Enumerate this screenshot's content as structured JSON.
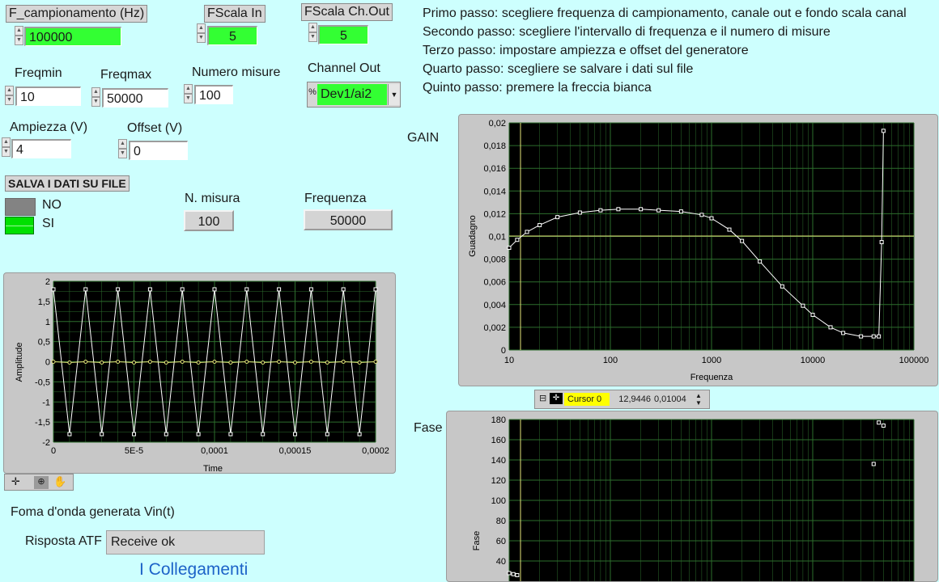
{
  "controls": {
    "f_camp": {
      "label": "F_campionamento (Hz)",
      "value": "100000"
    },
    "fscala_in": {
      "label": "FScala In",
      "value": "5"
    },
    "fscala_out": {
      "label": "FScala Ch.Out",
      "value": "5"
    },
    "freqmin": {
      "label": "Freqmin",
      "value": "10"
    },
    "freqmax": {
      "label": "Freqmax",
      "value": "50000"
    },
    "num_misure": {
      "label": "Numero misure",
      "value": "100"
    },
    "channel_out": {
      "label": "Channel Out",
      "value": "Dev1/ai2",
      "prefix": "%"
    },
    "ampiezza": {
      "label": "Ampiezza (V)",
      "value": "4"
    },
    "offset": {
      "label": "Offset (V)",
      "value": "0"
    }
  },
  "salva": {
    "title": "SALVA I DATI SU FILE",
    "options": [
      "NO",
      "SI"
    ],
    "selected": "SI"
  },
  "indicators": {
    "n_misura": {
      "label": "N. misura",
      "value": "100"
    },
    "frequenza": {
      "label": "Frequenza",
      "value": "50000"
    }
  },
  "instructions": [
    "Primo passo: scegliere frequenza di campionamento, canale out e fondo scala canal",
    "Secondo passo: scegliere l'intervallo di frequenza e il numero di misure",
    "Terzo passo: impostare ampiezza e offset del generatore",
    "Quarto passo: scegliere se salvare i dati sul file",
    "Quinto passo: premere la freccia bianca"
  ],
  "waveform": {
    "caption": "Foma d'onda generata Vin(t)",
    "xlabel": "Time",
    "ylabel": "Amplitude"
  },
  "risposta": {
    "label": "Risposta ATF",
    "value": "Receive ok"
  },
  "collegamenti": "I Collegamenti",
  "gain": {
    "title": "GAIN",
    "xlabel": "Frequenza",
    "ylabel": "Guadagno"
  },
  "cursor": {
    "name": "Cursor 0",
    "x": "12,9446",
    "y": "0,01004"
  },
  "fase": {
    "title": "Fase",
    "ylabel": "Fase"
  },
  "colors": {
    "background": "#cdfffe",
    "plot_bg": "#000000",
    "grid": "#2d6e2d",
    "trace": "#ffffff",
    "cursor": "#e6e67a",
    "numeric_green": "#33ff33"
  },
  "chart_data": [
    {
      "type": "line",
      "name": "waveform",
      "xlabel": "Time",
      "ylabel": "Amplitude",
      "xlim": [
        0,
        0.0002
      ],
      "ylim": [
        -2,
        2
      ],
      "x_ticks": [
        "0",
        "5E-5",
        "0,0001",
        "0,00015",
        "0,0002"
      ],
      "y_ticks": [
        "2",
        "1,5",
        "1",
        "0,5",
        "0",
        "-0,5",
        "-1",
        "-1,5",
        "-2"
      ],
      "series": [
        {
          "values_x": [
            0,
            1e-05,
            2e-05,
            3e-05,
            4e-05,
            5e-05,
            6e-05,
            7e-05,
            8e-05,
            9e-05,
            0.0001,
            0.00011,
            0.00012,
            0.00013,
            0.00014,
            0.00015,
            0.00016,
            0.00017,
            0.00018,
            0.00019,
            0.0002
          ],
          "values_y": [
            1.8,
            -1.8,
            1.8,
            -1.8,
            1.8,
            -1.8,
            1.8,
            -1.8,
            1.8,
            -1.8,
            1.8,
            -1.8,
            1.8,
            -1.8,
            1.8,
            -1.8,
            1.8,
            -1.8,
            1.8,
            -1.8,
            1.8
          ]
        },
        {
          "values_x": [
            0,
            1e-05,
            2e-05,
            3e-05,
            4e-05,
            5e-05,
            6e-05,
            7e-05,
            8e-05,
            9e-05,
            0.0001,
            0.00011,
            0.00012,
            0.00013,
            0.00014,
            0.00015,
            0.00016,
            0.00017,
            0.00018,
            0.00019,
            0.0002
          ],
          "values_y": [
            0,
            -0.02,
            0,
            -0.02,
            0,
            -0.02,
            0,
            -0.02,
            0,
            -0.02,
            0,
            -0.02,
            0,
            -0.02,
            0,
            -0.02,
            0,
            -0.02,
            0,
            -0.02,
            0
          ]
        }
      ]
    },
    {
      "type": "scatter",
      "name": "gain",
      "xlabel": "Frequenza",
      "ylabel": "Guadagno",
      "xscale": "log",
      "xlim": [
        10,
        100000
      ],
      "ylim": [
        0,
        0.02
      ],
      "x_ticks": [
        "10",
        "100",
        "1000",
        "10000",
        "100000"
      ],
      "y_ticks": [
        "0,02",
        "0,018",
        "0,016",
        "0,014",
        "0,012",
        "0,01",
        "0,008",
        "0,006",
        "0,004",
        "0,002",
        "0"
      ],
      "cursor": {
        "x": 12.9446,
        "y": 0.01004
      },
      "series": [
        {
          "x": [
            10,
            12,
            15,
            20,
            30,
            50,
            80,
            120,
            200,
            300,
            500,
            800,
            1000,
            1500,
            2000,
            3000,
            5000,
            8000,
            10000,
            15000,
            20000,
            30000,
            40000,
            45000,
            48000,
            50000
          ],
          "y": [
            0.009,
            0.0097,
            0.0104,
            0.011,
            0.0117,
            0.0121,
            0.0123,
            0.0124,
            0.0124,
            0.0123,
            0.0122,
            0.0119,
            0.0116,
            0.0106,
            0.0096,
            0.0078,
            0.0056,
            0.0039,
            0.0031,
            0.002,
            0.0015,
            0.0012,
            0.0012,
            0.0012,
            0.0095,
            0.0193
          ]
        }
      ]
    },
    {
      "type": "scatter",
      "name": "fase",
      "ylabel": "Fase",
      "xscale": "log",
      "xlim": [
        10,
        100000
      ],
      "ylim": [
        20,
        180
      ],
      "y_ticks": [
        "180",
        "160",
        "140",
        "120",
        "100",
        "80",
        "60",
        "40"
      ],
      "series": [
        {
          "x": [
            10,
            11,
            12,
            40000,
            45000,
            50000
          ],
          "y": [
            28,
            27,
            26,
            136,
            177,
            174
          ]
        }
      ]
    }
  ]
}
